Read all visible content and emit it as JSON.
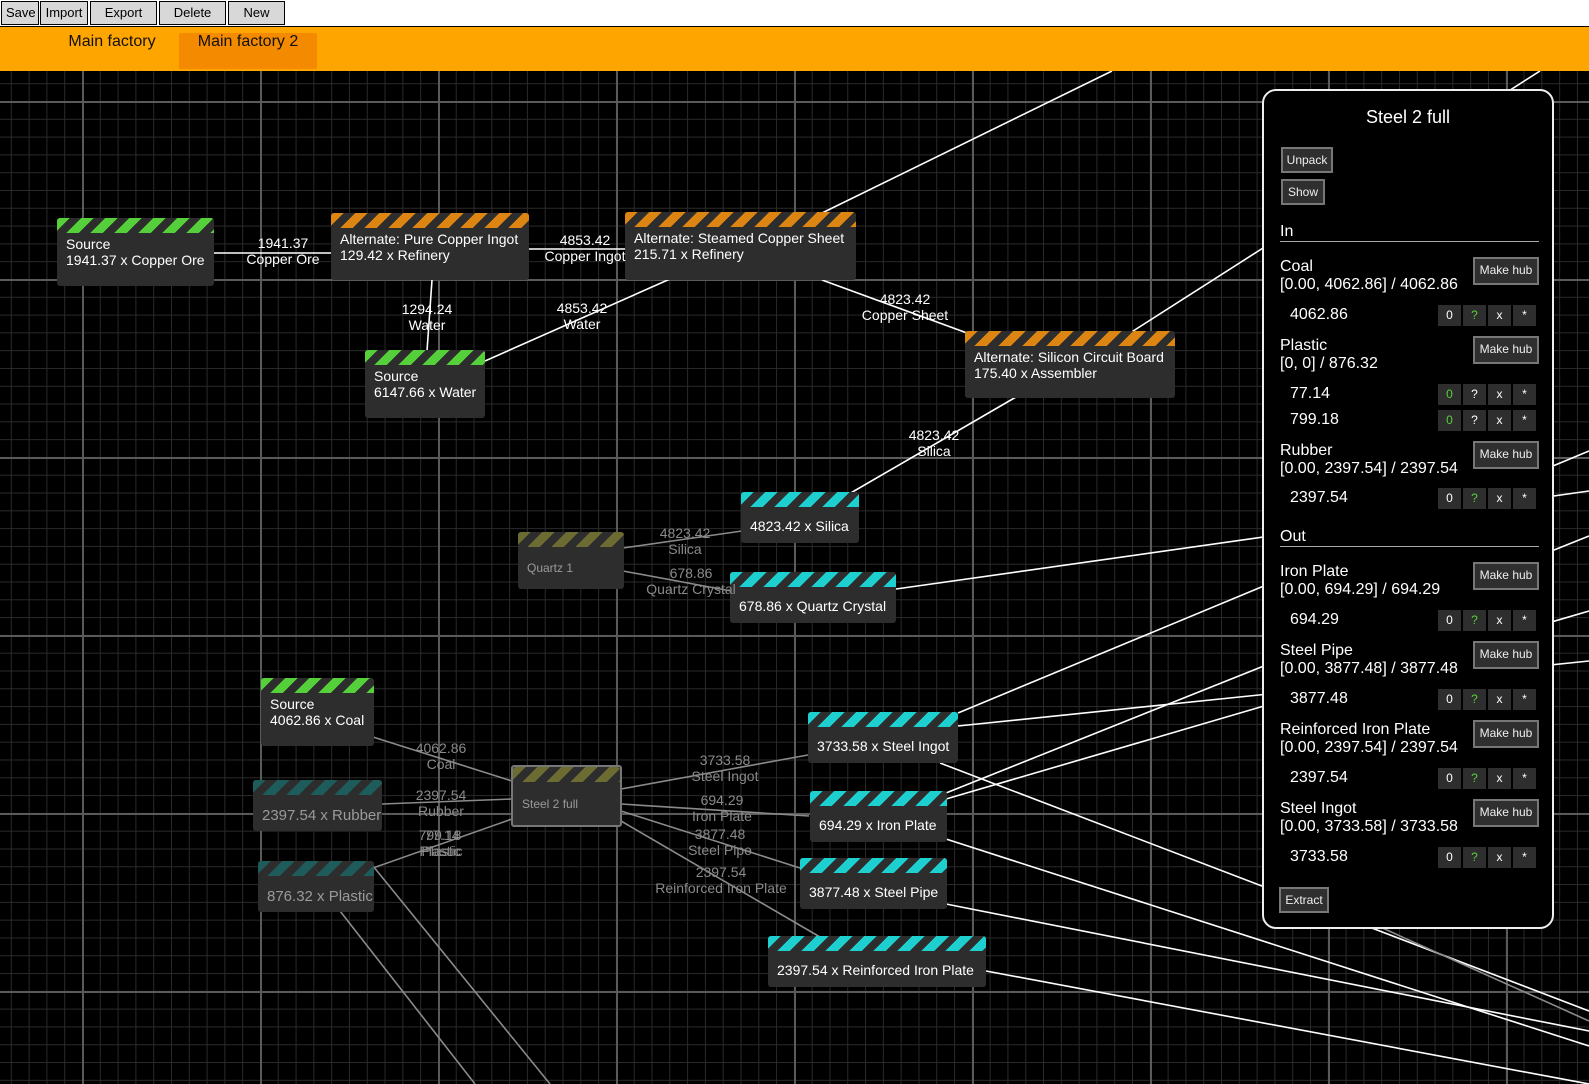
{
  "toolbar": {
    "save": "Save",
    "import": "Import",
    "export_tab": "Export tab",
    "delete_tab": "Delete tab",
    "new_tab": "New tab"
  },
  "tabs": [
    {
      "label": "Main factory"
    },
    {
      "label": "Main factory 2",
      "active": true
    }
  ],
  "nodes": {
    "src_copper": {
      "l1": "Source",
      "l2": "1941.37 x Copper Ore"
    },
    "pure_copper": {
      "l1": "Alternate: Pure Copper Ingot",
      "l2": "129.42 x Refinery"
    },
    "steamed_sheet": {
      "l1": "Alternate: Steamed Copper Sheet",
      "l2": "215.71 x Refinery"
    },
    "src_water": {
      "l1": "Source",
      "l2": "6147.66 x Water"
    },
    "silicon_board": {
      "l1": "Alternate: Silicon Circuit Board",
      "l2": "175.40 x Assembler"
    },
    "silica": {
      "l1": "4823.42 x Silica"
    },
    "quartz1": {
      "l1": "Quartz 1"
    },
    "quartz_crystal": {
      "l1": "678.86 x Quartz Crystal"
    },
    "src_coal": {
      "l1": "Source",
      "l2": "4062.86 x Coal"
    },
    "rubber": {
      "l1": "2397.54 x Rubber"
    },
    "plastic": {
      "l1": "876.32 x Plastic"
    },
    "steel2": {
      "l1": "Steel 2 full"
    },
    "steel_ingot": {
      "l1": "3733.58 x Steel Ingot"
    },
    "iron_plate": {
      "l1": "694.29 x Iron Plate"
    },
    "steel_pipe": {
      "l1": "3877.48 x Steel Pipe"
    },
    "rip": {
      "l1": "2397.54 x Reinforced Iron Plate"
    }
  },
  "edge_labels": [
    {
      "v": "1941.37",
      "n": "Copper Ore"
    },
    {
      "v": "4853.42",
      "n": "Copper Ingot"
    },
    {
      "v": "1294.24",
      "n": "Water"
    },
    {
      "v": "4853.42",
      "n": "Water"
    },
    {
      "v": "4823.42",
      "n": "Copper Sheet"
    },
    {
      "v": "4823.42",
      "n": "Silica"
    },
    {
      "v": "4823.42",
      "n": "Silica"
    },
    {
      "v": "678.86",
      "n": "Quartz Crystal"
    },
    {
      "v": "4062.86",
      "n": "Coal"
    },
    {
      "v": "2397.54",
      "n": "Rubber"
    },
    {
      "v": "799.18",
      "n": "Plastic"
    },
    {
      "v": "77.14",
      "n": "Plastic"
    },
    {
      "v": "3733.58",
      "n": "Steel Ingot"
    },
    {
      "v": "694.29",
      "n": "Iron Plate"
    },
    {
      "v": "3877.48",
      "n": "Steel Pipe"
    },
    {
      "v": "2397.54",
      "n": "Reinforced Iron Plate"
    }
  ],
  "panel": {
    "title": "Steel 2 full",
    "unpack": "Unpack",
    "show": "Show",
    "in_label": "In",
    "out_label": "Out",
    "make_hub": "Make hub",
    "extract": "Extract",
    "btn_zero": "0",
    "btn_q": "?",
    "btn_x": "x",
    "btn_star": "*",
    "inputs": [
      {
        "name": "Coal",
        "range": "[0.00, 4062.86] / 4062.86",
        "values": [
          "4062.86"
        ]
      },
      {
        "name": "Plastic",
        "range": "[0, 0] / 876.32",
        "values": [
          "77.14",
          "799.18"
        ]
      },
      {
        "name": "Rubber",
        "range": "[0.00, 2397.54] / 2397.54",
        "values": [
          "2397.54"
        ]
      }
    ],
    "outputs": [
      {
        "name": "Iron Plate",
        "range": "[0.00, 694.29] / 694.29",
        "values": [
          "694.29"
        ]
      },
      {
        "name": "Steel Pipe",
        "range": "[0.00, 3877.48] / 3877.48",
        "values": [
          "3877.48"
        ]
      },
      {
        "name": "Reinforced Iron Plate",
        "range": "[0.00, 2397.54] / 2397.54",
        "values": [
          "2397.54"
        ]
      },
      {
        "name": "Steel Ingot",
        "range": "[0.00, 3733.58] / 3733.58",
        "values": [
          "3733.58"
        ]
      }
    ]
  }
}
